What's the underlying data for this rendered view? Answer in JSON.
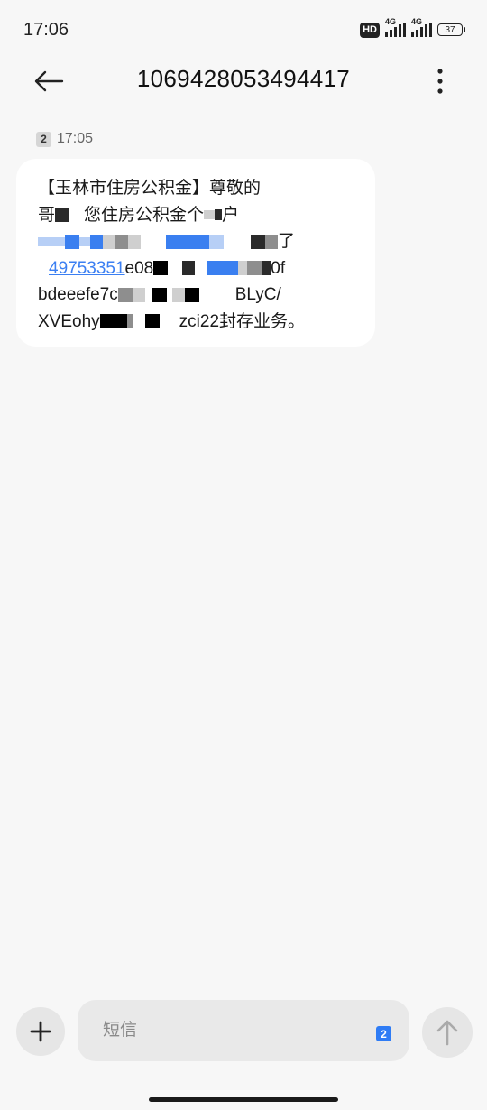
{
  "status_bar": {
    "time": "17:06",
    "hd_badge": "HD",
    "sim1_network": "4G",
    "sim2_network": "4G",
    "battery_level": "37"
  },
  "header": {
    "title": "1069428053494417",
    "back_icon": "arrow-left-icon",
    "more_icon": "more-vertical-icon"
  },
  "message": {
    "sim_slot": "2",
    "time": "17:05",
    "line1": "【玉林市住房公积金】尊敬的",
    "line2_prefix": "哥",
    "line2_text": "您住房公积金个",
    "line2_tail": "户",
    "line3_text": "了",
    "line4_link": "49753351",
    "line4_text": "e08",
    "line4_tail": "0f",
    "line5_text": "bdeeefe7c",
    "line5_tail": "BLyC/",
    "line6_text": "XVEohy",
    "line6_tail": "zci22封存业务。"
  },
  "composer": {
    "placeholder": "短信",
    "sim_slot": "2",
    "add_icon": "plus-icon",
    "send_icon": "arrow-up-icon"
  },
  "colors": {
    "background": "#f7f7f7",
    "bubble": "#ffffff",
    "link": "#3b7ff2",
    "sim_badge_active": "#2f7cf5"
  }
}
